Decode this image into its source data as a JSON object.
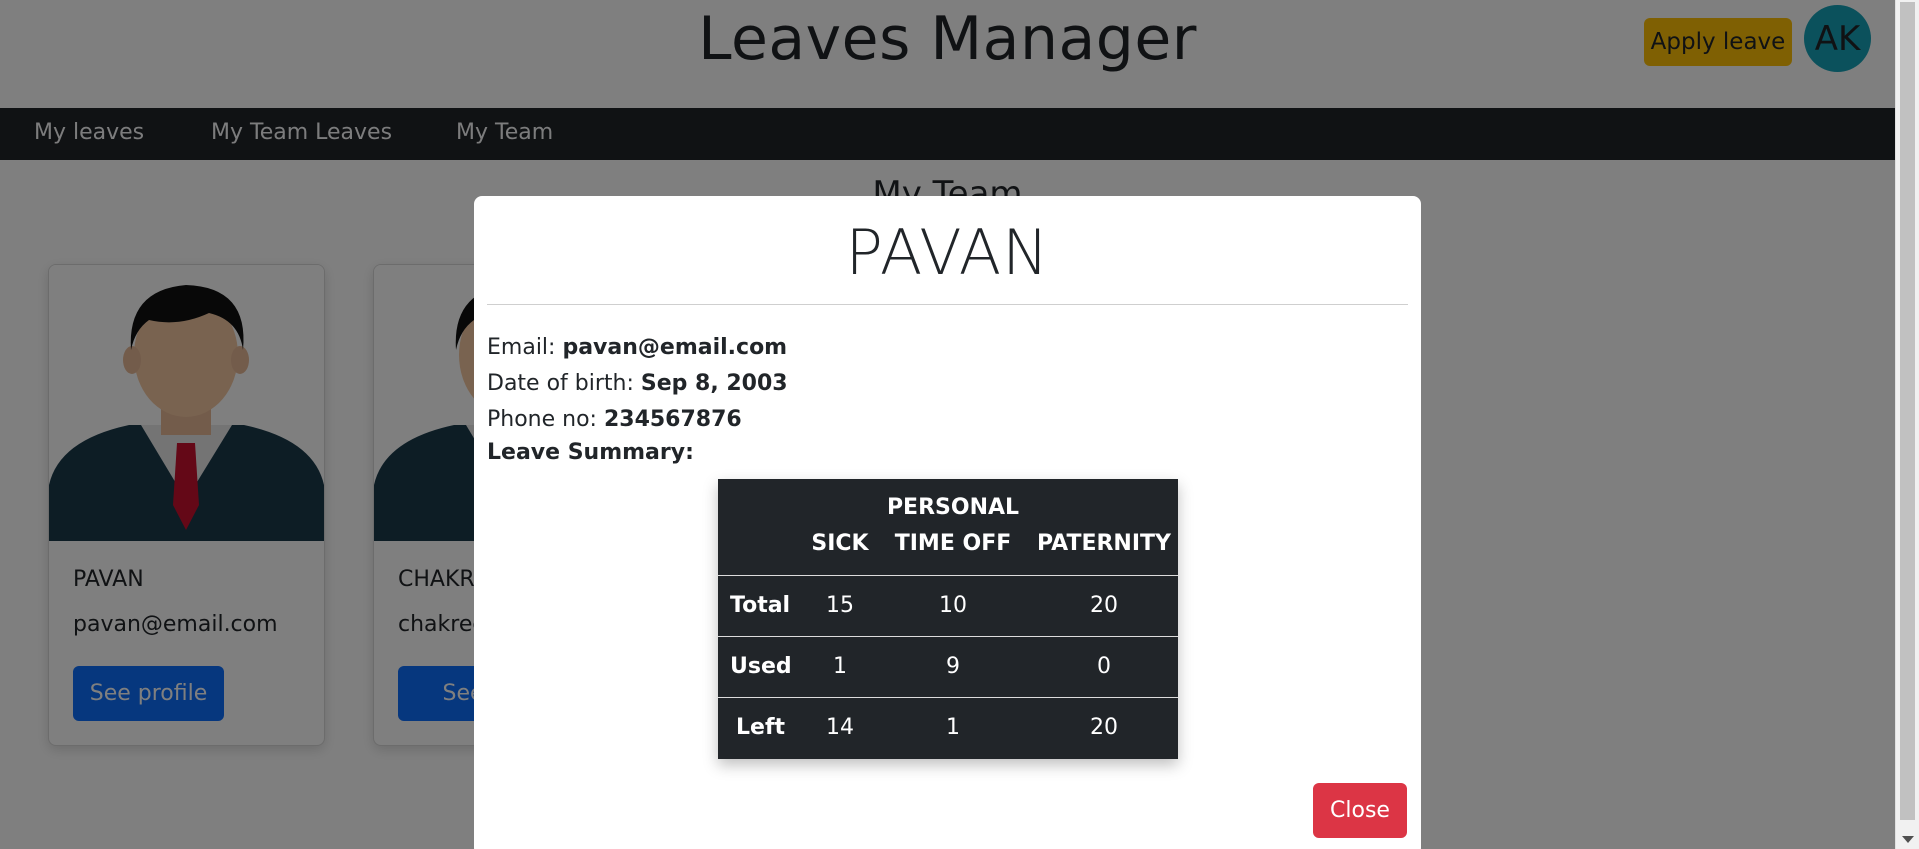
{
  "header": {
    "app_title": "Leaves Manager",
    "apply_button": "Apply leave",
    "avatar_initials": "AK"
  },
  "nav": {
    "items": [
      {
        "label": "My leaves"
      },
      {
        "label": "My Team Leaves"
      },
      {
        "label": "My Team"
      }
    ]
  },
  "page": {
    "section_title": "My Team"
  },
  "cards": [
    {
      "name": "PAVAN",
      "email": "pavan@email.com",
      "button": "See profile"
    },
    {
      "name": "CHAKR",
      "email": "chakree",
      "button": "See p"
    }
  ],
  "modal": {
    "title": "PAVAN",
    "email_label": "Email: ",
    "email_value": "pavan@email.com",
    "dob_label": "Date of birth: ",
    "dob_value": "Sep 8, 2003",
    "phone_label": "Phone no: ",
    "phone_value": "234567876",
    "summary_label": "Leave Summary:",
    "table": {
      "headers": [
        "SICK",
        "PERSONAL",
        "TIME OFF",
        "PATERNITY"
      ],
      "rows": [
        {
          "label": "Total",
          "values": [
            "15",
            "10",
            "20"
          ]
        },
        {
          "label": "Used",
          "values": [
            "1",
            "9",
            "0"
          ]
        },
        {
          "label": "Left",
          "values": [
            "14",
            "1",
            "20"
          ]
        }
      ]
    },
    "close_button": "Close"
  },
  "colors": {
    "navbar": "#212529",
    "apply": "#ffc107",
    "avatar": "#17a2b8",
    "primary": "#0d6efd",
    "danger": "#dc3545"
  }
}
